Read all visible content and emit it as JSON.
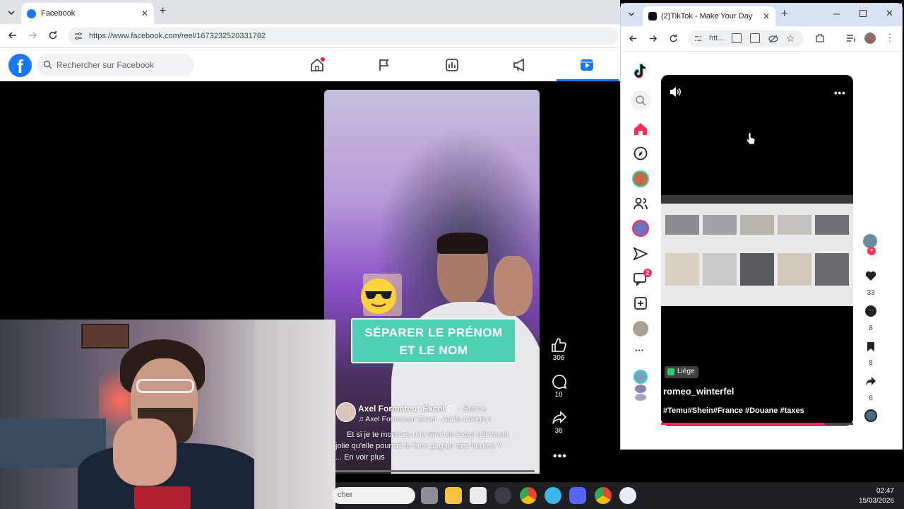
{
  "facebook_window": {
    "tab_title": "Facebook",
    "url": "https://www.facebook.com/reel/1673232520331782",
    "search_placeholder": "Rechercher sur Facebook"
  },
  "reel": {
    "banner_line1": "SÉPARER LE PRÉNOM",
    "banner_line2": "ET LE NOM",
    "author": "Axel Formateur Excel",
    "follow": "· Suivre",
    "audio": "♫ Axel Formateur Excel · Audio d'origine",
    "caption_line1": "Et si je te montrais une formule Excel tellement",
    "caption_line2": "jolie qu'elle pourrait te faire gagner des heures ?",
    "see_more": "... En voir plus",
    "likes": "306",
    "comments": "10",
    "shares": "36"
  },
  "taskbar": {
    "search_text": "cher",
    "time": "02:47",
    "date": "15/03/2026"
  },
  "tiktok_window": {
    "tab_title": "(2)TikTok - Make Your Day",
    "url_fragment": "htt...",
    "messages_badge": "2",
    "location_tag": "Liège",
    "username": "romeo_winterfel",
    "hashtags": "#Temu#Shein#France #Douane #taxes",
    "likes": "33",
    "comments": "8",
    "saves": "8",
    "shares": "6"
  },
  "colors": {
    "facebook_blue": "#1877f2",
    "tiktok_red": "#fe2c55",
    "banner_teal": "#4fd0b3"
  }
}
